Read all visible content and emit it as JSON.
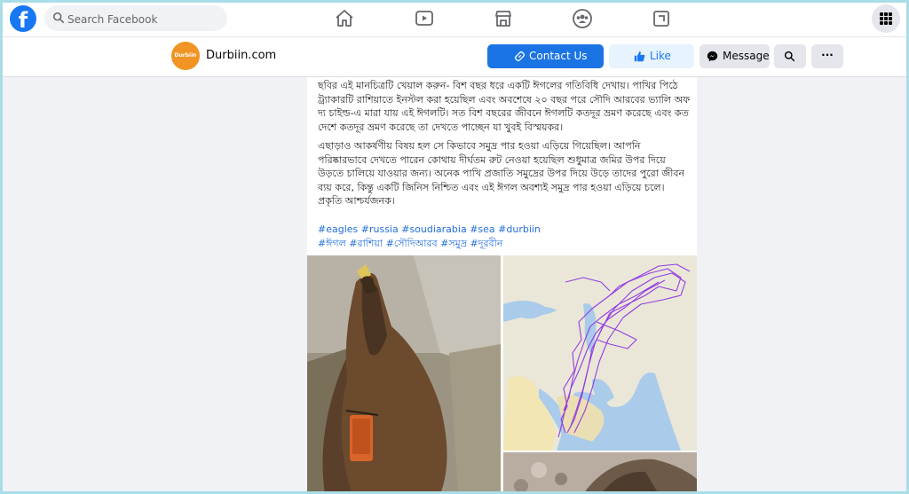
{
  "search": {
    "placeholder": "Search Facebook"
  },
  "page": {
    "name": "Durbiin.com",
    "avatar_text": "Durbiin"
  },
  "actions": {
    "contact": "Contact Us",
    "like": "Like",
    "message": "Message",
    "more": "···"
  },
  "post": {
    "paragraph1": "ছবির এই মানচিত্রটি খেয়াল করুন- বিশ বছর ধরে একটি ঈগলের গতিবিধি দেখায়। পাখির পিঠে ট্র্যাকারটি রাশিয়াতে ইনস্টল করা হয়েছিল এবং অবশেষে ২০ বছর পরে সৌদি আরবের ভ্যালি অফ দ্য চাইল্ড-এ মারা যায় এই ঈগলটি। সত বিশ বছরের জীবনে ঈগলটি কতদূর ভ্রমণ করেছে এবং কত দেশে কতদূর ভ্রমণ করেছে তা দেখতে পাচ্ছেন যা খুবই বিস্ময়কর।",
    "paragraph2": "এছাড়াও আকর্ষণীয় বিষয় হল সে কিভাবে সমুদ্র পার হওয়া এড়িয়ে গিয়েছিল। আপনি পরিষ্কারভাবে দেখতে পারেন কোথায় দীর্ঘতম রুট নেওয়া হয়েছিল শুধুমাত্র জমির উপর দিয়ে উড়তে চালিয়ে যাওয়ার জন্য। অনেক পাখি প্রজাতি সমুদ্রের উপর দিয়ে উড়ে তাদের পুরো জীবন ব্যয় করে, কিন্তু একটি জিনিস নিশ্চিত এবং এই ঈগল অবশ্যই সমুদ্র পার হওয়া এড়িয়ে চলে। প্রকৃতি আশ্চর্যজনক।",
    "hashtags_line1": "#eagles #russia #soudiarabia #sea #durbiin",
    "hashtags_line2": "#ঈগল #রাশিয়া #সৌদিআরব #সমুদ্র #দূরবীন"
  },
  "colors": {
    "brand": "#1877f2",
    "contact_bg": "#1b74e4",
    "like_bg": "#e7f3ff",
    "route": "#8a2be2"
  },
  "icons": [
    "facebook-logo",
    "search-icon",
    "home-icon",
    "watch-icon",
    "marketplace-icon",
    "groups-icon",
    "gaming-icon",
    "menu-grid-icon",
    "link-icon",
    "thumbs-up-icon",
    "messenger-icon",
    "search-icon",
    "more-icon"
  ]
}
